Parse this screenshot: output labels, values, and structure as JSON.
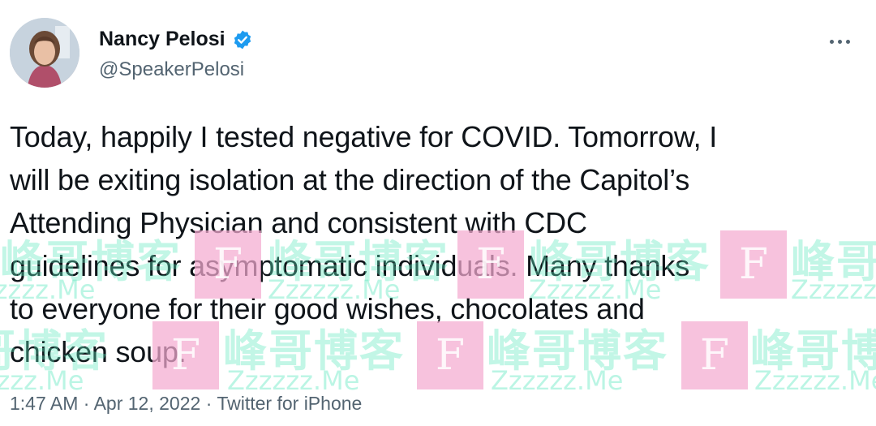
{
  "author": {
    "display_name": "Nancy Pelosi",
    "handle": "@SpeakerPelosi",
    "verified": true
  },
  "tweet": {
    "lines": [
      "Today, happily I tested negative for COVID. Tomorrow, I",
      "will be exiting isolation at the direction of the Capitol’s",
      "Attending Physician and consistent with CDC",
      "guidelines for asymptomatic individuals. Many thanks",
      "to everyone for their good wishes, chocolates and",
      "chicken soup."
    ]
  },
  "meta": {
    "time": "1:47 AM",
    "separator": "·",
    "date": "Apr 12, 2022",
    "source": "Twitter for iPhone"
  },
  "watermark": {
    "box_letter": "F",
    "cn_text": "峰哥博客",
    "latin_text": "Zzzzzz.Me"
  },
  "colors": {
    "verified": "#1d9bf0",
    "text": "#0f1419",
    "muted": "#536471"
  },
  "icons": {
    "more": "more-icon",
    "verified": "verified-badge-icon"
  }
}
